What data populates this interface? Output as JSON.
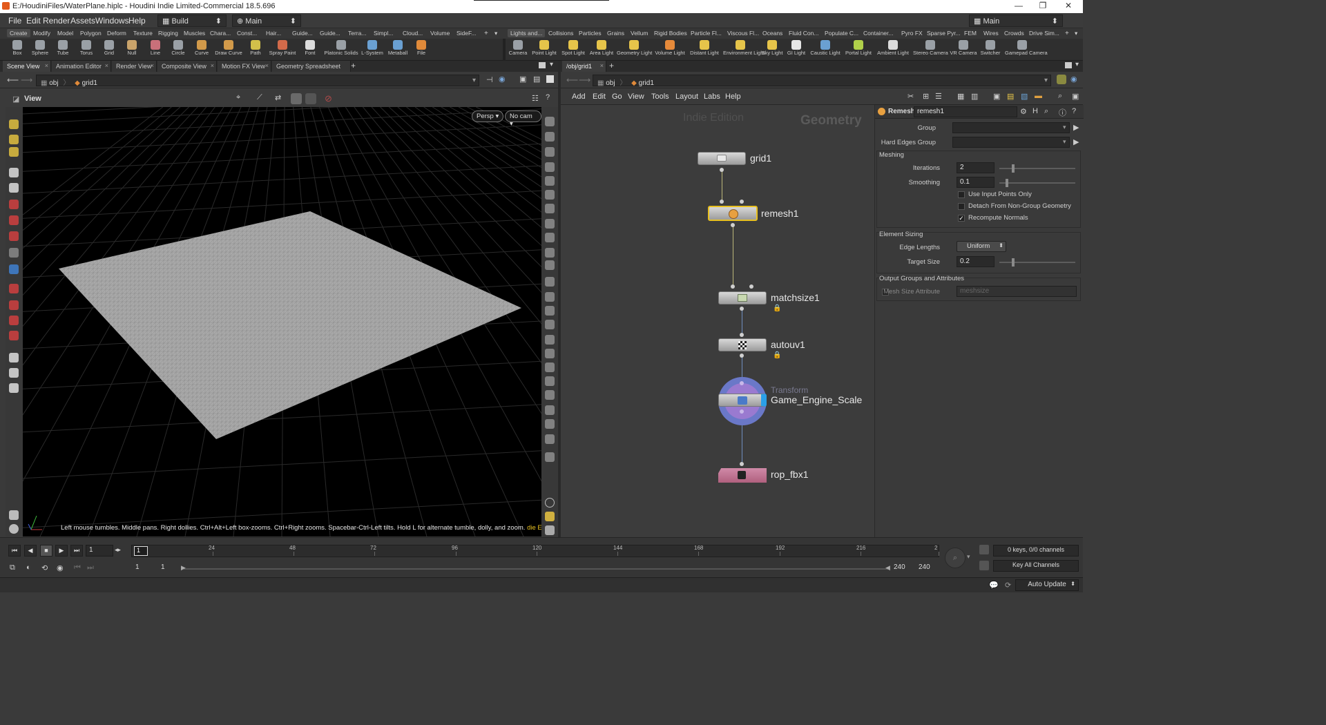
{
  "window": {
    "title": "E:/HoudiniFiles/WaterPlane.hiplc - Houdini Indie Limited-Commercial 18.5.696"
  },
  "menu": [
    "File",
    "Edit",
    "Render",
    "Assets",
    "Windows",
    "Help"
  ],
  "desktop": {
    "left": "Build",
    "middle": "Main",
    "right": "Main"
  },
  "shelf_tabs_left": [
    "Create",
    "Modify",
    "Model",
    "Polygon",
    "Deform",
    "Texture",
    "Rigging",
    "Muscles",
    "Chara...",
    "Const...",
    "Hair...",
    "Guide...",
    "Guide...",
    "Terra...",
    "Simpl...",
    "Cloud...",
    "Volume",
    "SideF..."
  ],
  "shelf_tabs_right": [
    "Lights and...",
    "Collisions",
    "Particles",
    "Grains",
    "Vellum",
    "Rigid Bodies",
    "Particle Fl...",
    "Viscous Fl...",
    "Oceans",
    "Fluid Con...",
    "Populate C...",
    "Container...",
    "Pyro FX",
    "Sparse Pyr...",
    "FEM",
    "Wires",
    "Crowds",
    "Drive Sim..."
  ],
  "shelf_tools_left": [
    {
      "label": "Box",
      "color": "#9aa0a6"
    },
    {
      "label": "Sphere",
      "color": "#9aa0a6"
    },
    {
      "label": "Tube",
      "color": "#9aa0a6"
    },
    {
      "label": "Torus",
      "color": "#9aa0a6"
    },
    {
      "label": "Grid",
      "color": "#9aa0a6"
    },
    {
      "label": "Null",
      "color": "#c9a36a"
    },
    {
      "label": "Line",
      "color": "#c9707a"
    },
    {
      "label": "Circle",
      "color": "#9aa0a6"
    },
    {
      "label": "Curve",
      "color": "#d29a4a"
    },
    {
      "label": "Draw Curve",
      "color": "#d29a4a"
    },
    {
      "label": "Path",
      "color": "#d2c04a"
    },
    {
      "label": "Spray Paint",
      "color": "#d26a4a"
    },
    {
      "label": "Font",
      "color": "#dcdcdc"
    },
    {
      "label": "Platonic Solids",
      "color": "#9aa0a6"
    },
    {
      "label": "L-System",
      "color": "#6aa0d2"
    },
    {
      "label": "Metaball",
      "color": "#6aa0d2"
    },
    {
      "label": "File",
      "color": "#e08a3a"
    }
  ],
  "shelf_tools_right": [
    {
      "label": "Camera",
      "color": "#9aa0a6"
    },
    {
      "label": "Point Light",
      "color": "#e6c44a"
    },
    {
      "label": "Spot Light",
      "color": "#e6c44a"
    },
    {
      "label": "Area Light",
      "color": "#e6c44a"
    },
    {
      "label": "Geometry Light",
      "color": "#e6c44a"
    },
    {
      "label": "Volume Light",
      "color": "#e68a3a"
    },
    {
      "label": "Distant Light",
      "color": "#e6c44a"
    },
    {
      "label": "Environment Light",
      "color": "#e6c44a"
    },
    {
      "label": "Sky Light",
      "color": "#e6c44a"
    },
    {
      "label": "GI Light",
      "color": "#e6e6e6"
    },
    {
      "label": "Caustic Light",
      "color": "#6aa0d2"
    },
    {
      "label": "Portal Light",
      "color": "#b0d04a"
    },
    {
      "label": "Ambient Light",
      "color": "#dcdcdc"
    },
    {
      "label": "Stereo Camera",
      "color": "#9aa0a6"
    },
    {
      "label": "VR Camera",
      "color": "#9aa0a6"
    },
    {
      "label": "Switcher",
      "color": "#9aa0a6"
    },
    {
      "label": "Gamepad Camera",
      "color": "#9aa0a6"
    }
  ],
  "left_pane_tabs": [
    "Scene View",
    "Animation Editor",
    "Render View",
    "Composite View",
    "Motion FX View",
    "Geometry Spreadsheet"
  ],
  "right_pane_tabs": [
    "/obj/grid1"
  ],
  "path": {
    "level1": "obj",
    "level2": "grid1"
  },
  "viewer": {
    "label": "View",
    "persp": "Persp",
    "cam": "No cam",
    "help_text": "Left mouse tumbles. Middle pans. Right dollies. Ctrl+Alt+Left box-zooms. Ctrl+Right zooms. Spacebar-Ctrl-Left tilts. Hold L for alternate tumble, dolly, and zoom.",
    "edition_tag": "die Edition"
  },
  "network": {
    "menu": [
      "Add",
      "Edit",
      "Go",
      "View",
      "Tools",
      "Layout",
      "Labs",
      "Help"
    ],
    "watermark_edition": "Indie Edition",
    "watermark_context": "Geometry",
    "nodes": {
      "grid": "grid1",
      "remesh": "remesh1",
      "matchsize": "matchsize1",
      "autouv": "autouv1",
      "transform_type": "Transform",
      "transform": "Game_Engine_Scale",
      "rop": "rop_fbx1"
    }
  },
  "params": {
    "node_type": "Remesh",
    "node_name": "remesh1",
    "group_label": "Group",
    "group_value": "",
    "hard_edges_label": "Hard Edges Group",
    "hard_edges_value": "",
    "meshing_label": "Meshing",
    "iterations_label": "Iterations",
    "iterations": "2",
    "smoothing_label": "Smoothing",
    "smoothing": "0.1",
    "use_input_points": "Use Input Points Only",
    "detach": "Detach From Non-Group Geometry",
    "recompute": "Recompute Normals",
    "checkmark": "✓",
    "element_sizing_label": "Element Sizing",
    "edge_lengths_label": "Edge Lengths",
    "edge_lengths": "Uniform",
    "target_size_label": "Target Size",
    "target_size": "0.2",
    "output_label": "Output Groups and Attributes",
    "mesh_size_label": "Mesh Size Attribute",
    "mesh_size_value": "meshsize"
  },
  "timeline": {
    "current_frame": "1",
    "marker": "1",
    "ticks": [
      "24",
      "48",
      "72",
      "96",
      "120",
      "144",
      "168",
      "192",
      "216",
      "2"
    ],
    "range_start": "1",
    "range_start2": "1",
    "range_end": "240",
    "range_end2": "240",
    "keys_info": "0 keys, 0/0 channels",
    "key_all": "Key All Channels"
  },
  "status": {
    "auto_update": "Auto Update"
  }
}
